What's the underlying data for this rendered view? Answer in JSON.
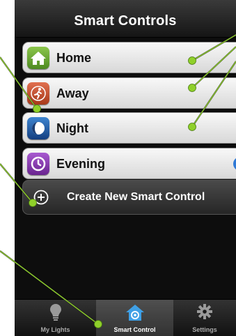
{
  "nav": {
    "title": "Smart Controls"
  },
  "controls": [
    {
      "label": "Home",
      "icon": "home-icon",
      "color": "#6aa234"
    },
    {
      "label": "Away",
      "icon": "running-person-icon",
      "color": "#c5512b"
    },
    {
      "label": "Night",
      "icon": "moon-icon",
      "color": "#1e5fa8"
    },
    {
      "label": "Evening",
      "icon": "clock-icon",
      "color": "#8e3ab5"
    }
  ],
  "create": {
    "label": "Create New Smart Control"
  },
  "tabs": [
    {
      "label": "My Lights",
      "icon": "lightbulb-icon"
    },
    {
      "label": "Smart Control",
      "icon": "smart-home-icon"
    },
    {
      "label": "Settings",
      "icon": "gear-icon"
    }
  ],
  "selected_tab": "Smart Control",
  "callout_color": "#7dbb1e"
}
